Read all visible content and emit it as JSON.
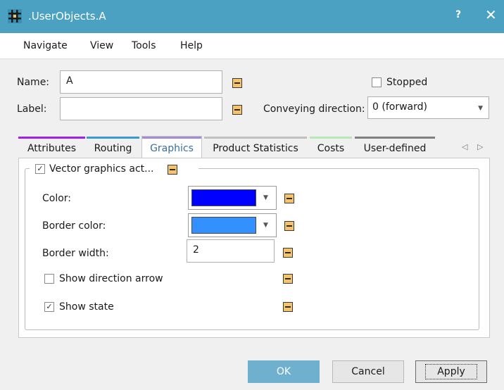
{
  "window": {
    "title": ".UserObjects.A",
    "help_label": "?",
    "close_label": "✕"
  },
  "menu": [
    "Navigate",
    "View",
    "Tools",
    "Help"
  ],
  "form": {
    "name_label": "Name:",
    "name_value": "A",
    "label_label": "Label:",
    "label_value": "",
    "stopped_label": "Stopped",
    "stopped_checked": false,
    "conveying_label": "Conveying direction:",
    "conveying_value": "0 (forward)"
  },
  "tabs": [
    {
      "label": "Attributes",
      "color": "#a020f0"
    },
    {
      "label": "Routing",
      "color": "#3a9ad9"
    },
    {
      "label": "Graphics",
      "color": "#a58ad8",
      "active": true
    },
    {
      "label": "Product Statistics",
      "color": "#c0c0c0"
    },
    {
      "label": "Costs",
      "color": "#b6e8b6"
    },
    {
      "label": "User-defined",
      "color": "#808080"
    }
  ],
  "tab_scroll": {
    "left": "◁",
    "right": "▷"
  },
  "graphics": {
    "group_label": "Vector graphics act...",
    "group_checked": true,
    "color_label": "Color:",
    "color_value": "#0000ff",
    "border_color_label": "Border color:",
    "border_color_value": "#3391ff",
    "border_width_label": "Border width:",
    "border_width_value": "2",
    "show_arrow_label": "Show direction arrow",
    "show_arrow_checked": false,
    "show_state_label": "Show state",
    "show_state_checked": true
  },
  "buttons": {
    "ok": "OK",
    "cancel": "Cancel",
    "apply": "Apply"
  }
}
